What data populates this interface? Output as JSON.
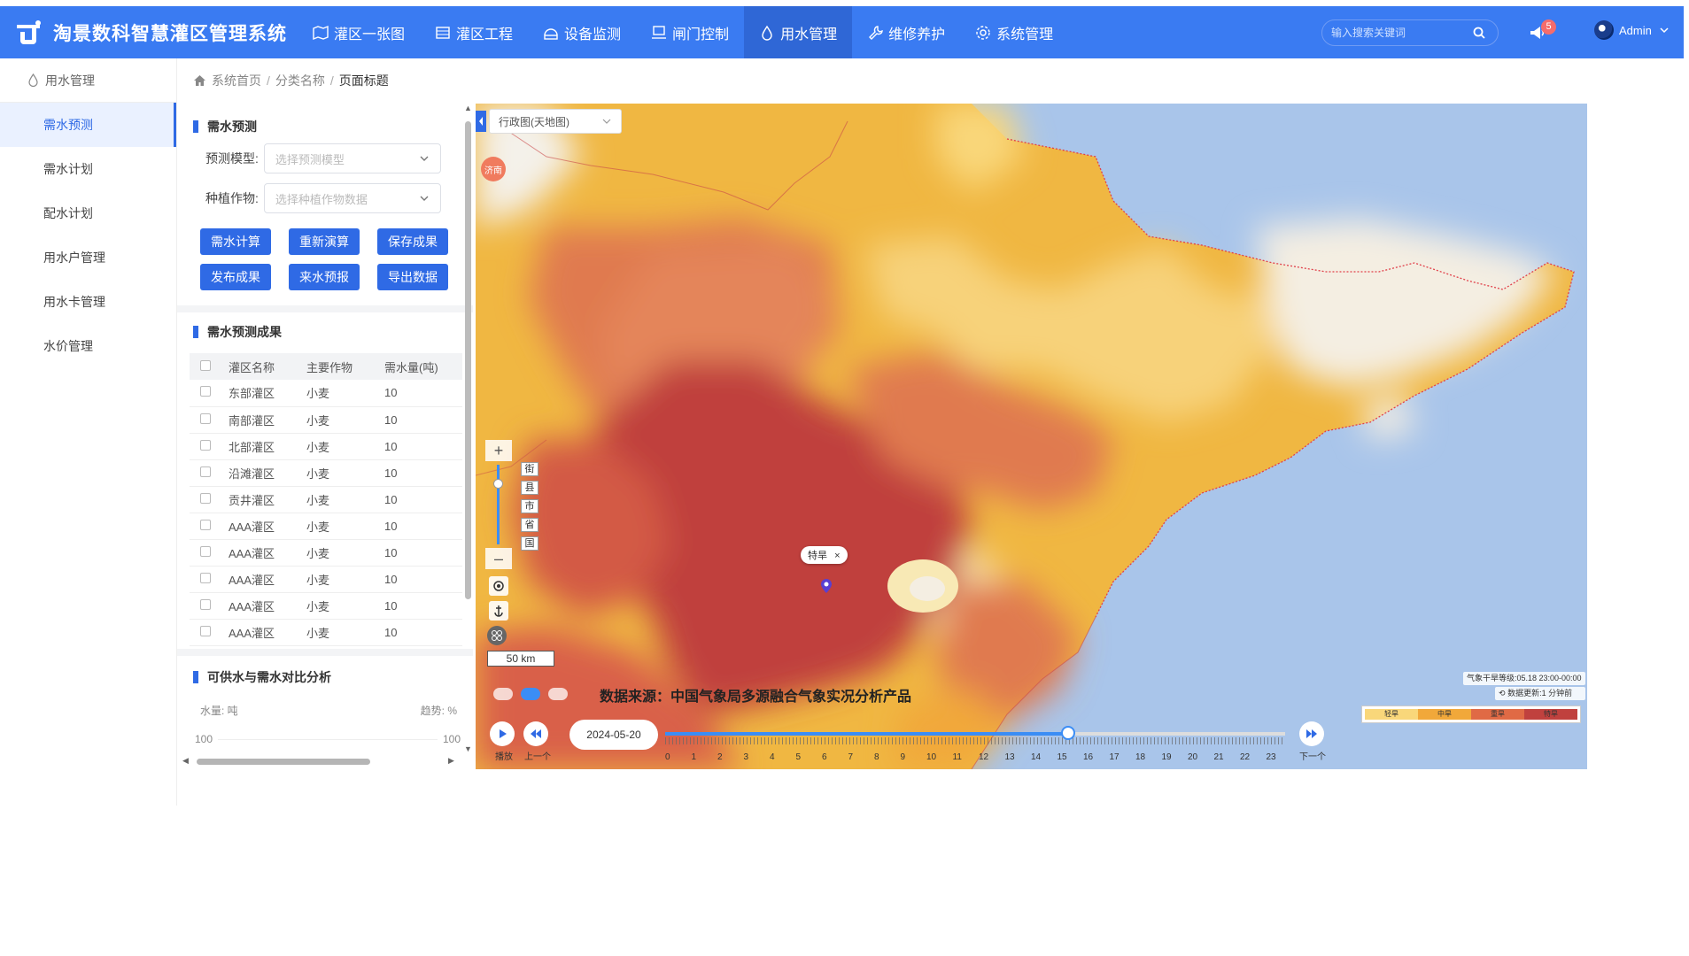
{
  "app": {
    "title": "淘景数科智慧灌区管理系统"
  },
  "nav": {
    "items": [
      {
        "label": "灌区一张图",
        "icon": "map-icon"
      },
      {
        "label": "灌区工程",
        "icon": "building-icon"
      },
      {
        "label": "设备监测",
        "icon": "monitor-icon"
      },
      {
        "label": "闸门控制",
        "icon": "gate-icon"
      },
      {
        "label": "用水管理",
        "icon": "water-drop-icon",
        "active": true
      },
      {
        "label": "维修养护",
        "icon": "wrench-icon"
      },
      {
        "label": "系统管理",
        "icon": "gear-icon"
      }
    ]
  },
  "search": {
    "placeholder": "输入搜索关键词"
  },
  "notifications": {
    "count": "5"
  },
  "user": {
    "name": "Admin"
  },
  "sidebar": {
    "header": "用水管理",
    "items": [
      {
        "label": "需水预测",
        "active": true
      },
      {
        "label": "需水计划"
      },
      {
        "label": "配水计划"
      },
      {
        "label": "用水户管理"
      },
      {
        "label": "用水卡管理"
      },
      {
        "label": "水价管理"
      }
    ]
  },
  "breadcrumb": {
    "home": "系统首页",
    "category": "分类名称",
    "current": "页面标题"
  },
  "forecast": {
    "title": "需水预测",
    "model_label": "预测模型:",
    "model_placeholder": "选择预测模型",
    "crop_label": "种植作物:",
    "crop_placeholder": "选择种植作物数据",
    "buttons": [
      "需水计算",
      "重新演算",
      "保存成果",
      "发布成果",
      "来水预报",
      "导出数据"
    ]
  },
  "results": {
    "title": "需水预测成果",
    "columns": [
      "灌区名称",
      "主要作物",
      "需水量(吨)"
    ],
    "rows": [
      [
        "东部灌区",
        "小麦",
        "10"
      ],
      [
        "南部灌区",
        "小麦",
        "10"
      ],
      [
        "北部灌区",
        "小麦",
        "10"
      ],
      [
        "沿滩灌区",
        "小麦",
        "10"
      ],
      [
        "贡井灌区",
        "小麦",
        "10"
      ],
      [
        "AAA灌区",
        "小麦",
        "10"
      ],
      [
        "AAA灌区",
        "小麦",
        "10"
      ],
      [
        "AAA灌区",
        "小麦",
        "10"
      ],
      [
        "AAA灌区",
        "小麦",
        "10"
      ],
      [
        "AAA灌区",
        "小麦",
        "10"
      ]
    ]
  },
  "compare": {
    "title": "可供水与需水对比分析",
    "left_axis": "水量: 吨",
    "right_axis": "趋势: %",
    "left_tick": "100",
    "right_tick": "100"
  },
  "map": {
    "layer": "行政图(天地图)",
    "city_badge": "济南",
    "levels": [
      "街",
      "县",
      "市",
      "省",
      "国"
    ],
    "scale": "50 km",
    "source": "数据来源：中国气象局多源融合气象实况分析产品",
    "popup": "特旱",
    "play_label": "播放",
    "prev_label": "上一个",
    "next_label": "下一个",
    "date": "2024-05-20",
    "timeline_progress": 0.65,
    "hours": [
      "1",
      "2",
      "3",
      "4",
      "5",
      "6",
      "7",
      "8",
      "9",
      "10",
      "11",
      "12",
      "13",
      "14",
      "15",
      "16",
      "17",
      "18",
      "19",
      "20",
      "21",
      "22",
      "23"
    ],
    "hour_zero": "0",
    "legend_title": "气象干旱等级:05.18 23:00-00:00",
    "legend_update": "数据更新:1 分钟前",
    "legend": [
      {
        "label": "轻旱",
        "color": "#f9d77a"
      },
      {
        "label": "中旱",
        "color": "#f1a83a"
      },
      {
        "label": "重旱",
        "color": "#e06a45"
      },
      {
        "label": "特旱",
        "color": "#c0413e"
      }
    ]
  }
}
